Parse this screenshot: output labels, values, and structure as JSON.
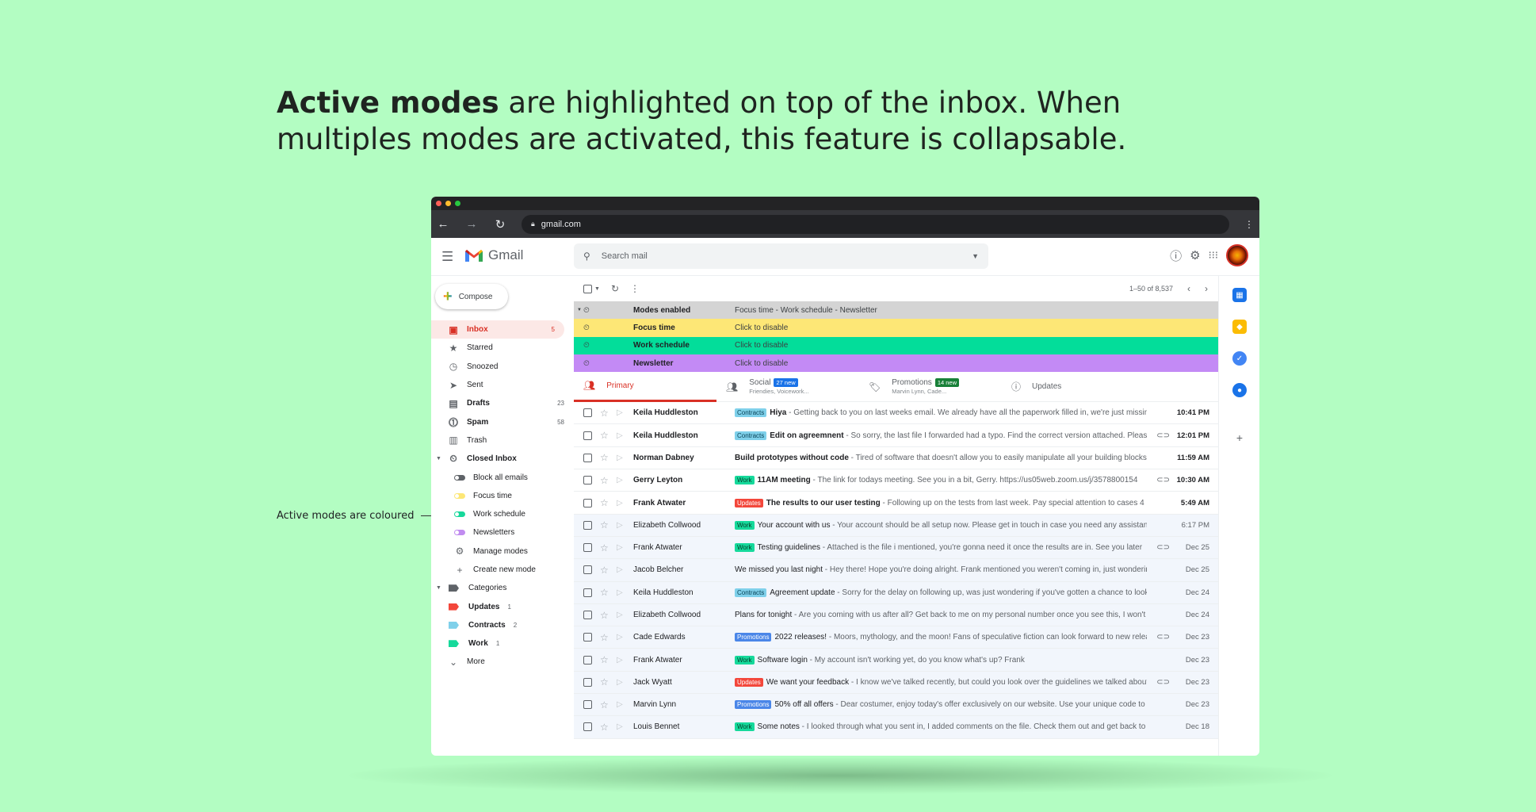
{
  "headline": {
    "bold": "Active modes",
    "rest": " are highlighted on top of the inbox. When multiples modes are activated, this feature is collapsable."
  },
  "annotation": "Active modes are coloured",
  "browser": {
    "url": "gmail.com",
    "traffic_lights": [
      "#ff5f57",
      "#febc2e",
      "#28c840"
    ]
  },
  "gmail": {
    "app_name": "Gmail",
    "search_placeholder": "Search mail",
    "compose_label": "Compose",
    "pager": "1–50 of 8,537",
    "nav": [
      {
        "label": "Inbox",
        "icon": "inbox-icon",
        "count": "5",
        "active": true
      },
      {
        "label": "Starred",
        "icon": "star-icon",
        "count": ""
      },
      {
        "label": "Snoozed",
        "icon": "clock-icon",
        "count": ""
      },
      {
        "label": "Sent",
        "icon": "send-icon",
        "count": ""
      },
      {
        "label": "Drafts",
        "icon": "draft-icon",
        "count": "23",
        "bold": true
      },
      {
        "label": "Spam",
        "icon": "spam-icon",
        "count": "58",
        "bold": true
      },
      {
        "label": "Trash",
        "icon": "trash-icon",
        "count": ""
      },
      {
        "label": "Closed Inbox",
        "icon": "closed-inbox-icon",
        "count": "",
        "bold": true
      }
    ],
    "closed_inbox_items": [
      {
        "label": "Block all emails",
        "color": "#5f6368"
      },
      {
        "label": "Focus time",
        "color": "#fde776"
      },
      {
        "label": "Work schedule",
        "color": "#17d89b"
      },
      {
        "label": "Newsletters",
        "color": "#c18cf0"
      },
      {
        "label": "Manage modes",
        "icon": "gear-icon"
      },
      {
        "label": "Create new mode",
        "icon": "plus-icon"
      }
    ],
    "categories_label": "Categories",
    "categories": [
      {
        "label": "Updates",
        "count": "1",
        "color": "#f3473b"
      },
      {
        "label": "Contracts",
        "count": "2",
        "color": "#7fd0ea"
      },
      {
        "label": "Work",
        "count": "1",
        "color": "#16d99b"
      }
    ],
    "more_label": "More",
    "modes": {
      "header": {
        "name": "Modes enabled",
        "desc": "Focus time - Work schedule - Newsletter",
        "color": "#d4d4d4"
      },
      "items": [
        {
          "name": "Focus time",
          "desc": "Click to disable",
          "color": "#fde776"
        },
        {
          "name": "Work schedule",
          "desc": "Click to disable",
          "color": "#03dd9a"
        },
        {
          "name": "Newsletter",
          "desc": "Click to disable",
          "color": "#c38af5"
        }
      ]
    },
    "tabs": [
      {
        "label": "Primary",
        "icon": "people-icon",
        "active": true
      },
      {
        "label": "Social",
        "icon": "people-icon",
        "badge": "27 new",
        "badge_color": "#1a73e8",
        "sub": "Friendies, Voicework..."
      },
      {
        "label": "Promotions",
        "icon": "tag-icon",
        "badge": "14 new",
        "badge_color": "#188038",
        "sub": "Marvin Lynn, Cade..."
      },
      {
        "label": "Updates",
        "icon": "info-icon"
      }
    ],
    "emails": [
      {
        "sender": "Keila Huddleston",
        "label": "Contracts",
        "subject": "Hiya",
        "snippet": " - Getting back to you on last weeks email. We already have all the paperwork filled in, we're just missing",
        "date": "10:41 PM",
        "unread": true,
        "attach": false
      },
      {
        "sender": "Keila Huddleston",
        "label": "Contracts",
        "subject": "Edit on agreemnent",
        "snippet": " - So sorry, the last file I forwarded had a typo. Find the correct version attached. Please",
        "date": "12:01 PM",
        "unread": true,
        "attach": true
      },
      {
        "sender": "Norman Dabney",
        "label": "",
        "subject": "Build prototypes without code",
        "snippet": " - Tired of software that doesn't allow you to easily manipulate all your building blocks",
        "date": "11:59 AM",
        "unread": true,
        "attach": false
      },
      {
        "sender": "Gerry Leyton",
        "label": "Work",
        "subject": "11AM meeting",
        "snippet": " - The link for todays meeting. See you in a bit, Gerry. https://us05web.zoom.us/j/3578800154",
        "date": "10:30 AM",
        "unread": true,
        "attach": true
      },
      {
        "sender": "Frank Atwater",
        "label": "Updates",
        "subject": "The results to our user testing",
        "snippet": " - Following up on the tests from last week. Pay special attention to cases 4",
        "date": "5:49 AM",
        "unread": true,
        "attach": false
      },
      {
        "sender": "Elizabeth Collwood",
        "label": "Work",
        "subject": "Your account with us",
        "snippet": " - Your account should be all setup now. Please get in touch in case you need any assistance",
        "date": "6:17 PM",
        "unread": false,
        "attach": false
      },
      {
        "sender": "Frank Atwater",
        "label": "Work",
        "subject": "Testing guidelines",
        "snippet": " - Attached is the file i mentioned, you're gonna need it once the results are in. See you later",
        "date": "Dec 25",
        "unread": false,
        "attach": true
      },
      {
        "sender": "Jacob Belcher",
        "label": "",
        "subject": "We missed you last night",
        "snippet": " - Hey there! Hope you're doing alright. Frank mentioned you weren't coming in, just wondering",
        "date": "Dec 25",
        "unread": false,
        "attach": false
      },
      {
        "sender": "Keila Huddleston",
        "label": "Contracts",
        "subject": "Agreement update",
        "snippet": " - Sorry for the delay on following up, was just wondering if you've gotten a chance to look",
        "date": "Dec 24",
        "unread": false,
        "attach": false
      },
      {
        "sender": "Elizabeth Collwood",
        "label": "",
        "subject": "Plans for tonight",
        "snippet": " - Are you coming with us after all? Get back to me on my personal number once you see this, I won't",
        "date": "Dec 24",
        "unread": false,
        "attach": false
      },
      {
        "sender": "Cade Edwards",
        "label": "Promotions",
        "subject": "2022 releases!",
        "snippet": " - Moors, mythology, and the moon! Fans of speculative fiction can look forward to new releases",
        "date": "Dec 23",
        "unread": false,
        "attach": true
      },
      {
        "sender": "Frank Atwater",
        "label": "Work",
        "subject": "Software login",
        "snippet": " - My account isn't working yet, do you know what's up? Frank",
        "date": "Dec 23",
        "unread": false,
        "attach": false
      },
      {
        "sender": "Jack Wyatt",
        "label": "Updates",
        "subject": "We want your feedback",
        "snippet": " - I know we've talked recently, but could you look over the guidelines we talked about",
        "date": "Dec 23",
        "unread": false,
        "attach": true
      },
      {
        "sender": "Marvin Lynn",
        "label": "Promotions",
        "subject": "50% off all offers",
        "snippet": " - Dear costumer, enjoy today's offer exclusively on our website. Use your unique code to",
        "date": "Dec 23",
        "unread": false,
        "attach": false
      },
      {
        "sender": "Louis Bennet",
        "label": "Work",
        "subject": "Some notes",
        "snippet": " - I looked through what you sent in, I added comments on the file. Check them out and get back to me",
        "date": "Dec 18",
        "unread": false,
        "attach": false
      }
    ]
  }
}
